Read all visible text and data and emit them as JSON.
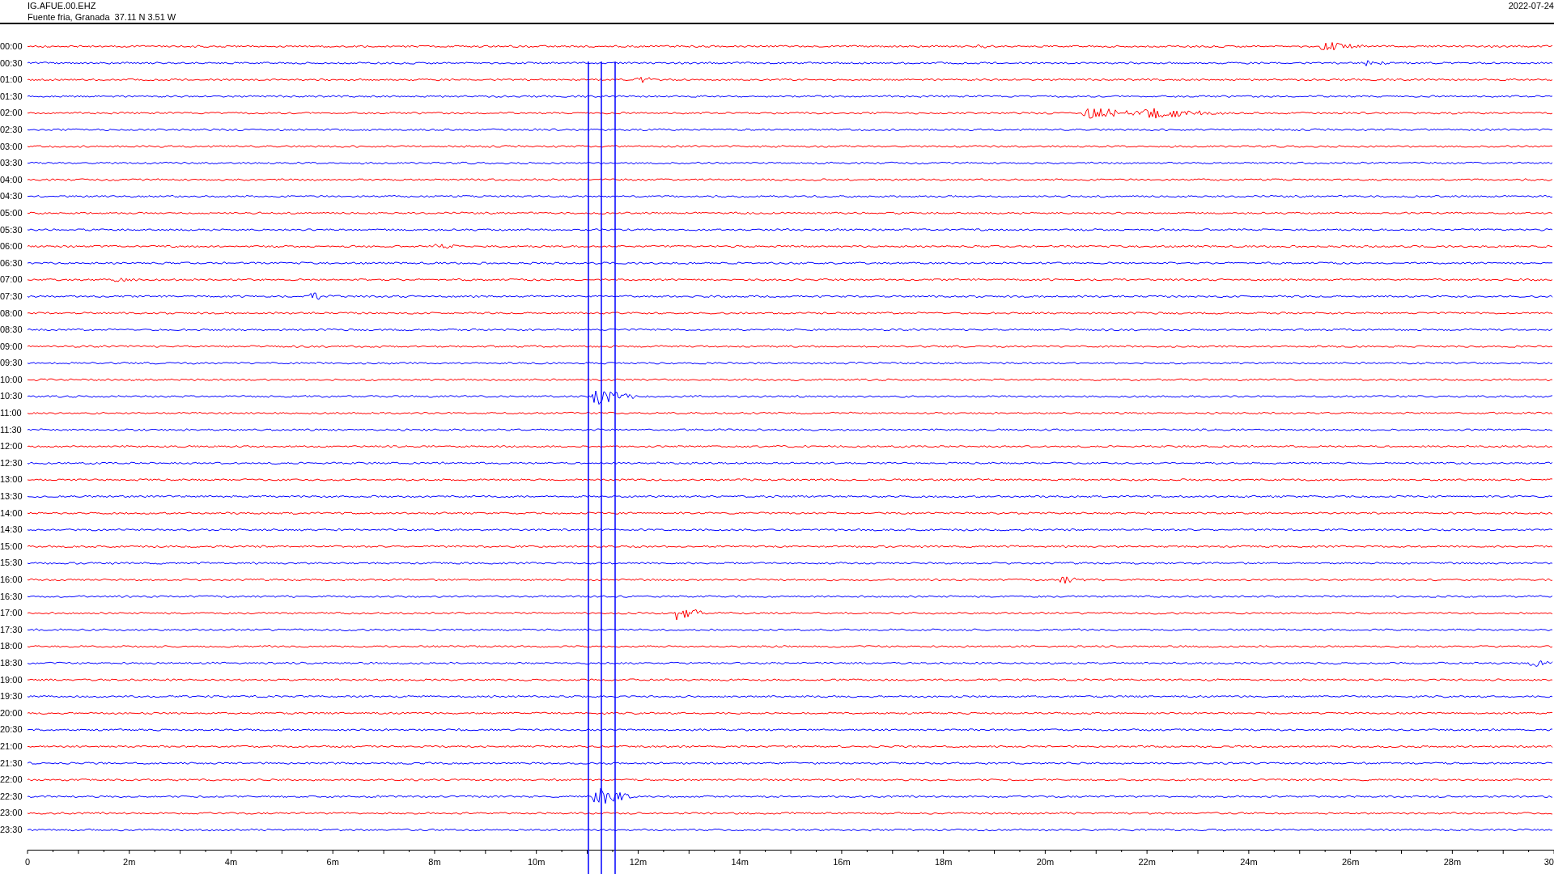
{
  "header": {
    "station": "IG.AFUE.00.EHZ",
    "location": "Fuente fria, Granada  37.11 N 3.51 W",
    "date": "2022-07-24"
  },
  "rows": [
    {
      "time": "00:00",
      "color": "#ff0000"
    },
    {
      "time": "00:30",
      "color": "#0000ff"
    },
    {
      "time": "01:00",
      "color": "#ff0000"
    },
    {
      "time": "01:30",
      "color": "#0000ff"
    },
    {
      "time": "02:00",
      "color": "#ff0000"
    },
    {
      "time": "02:30",
      "color": "#0000ff"
    },
    {
      "time": "03:00",
      "color": "#ff0000"
    },
    {
      "time": "03:30",
      "color": "#0000ff"
    },
    {
      "time": "04:00",
      "color": "#ff0000"
    },
    {
      "time": "04:30",
      "color": "#0000ff"
    },
    {
      "time": "05:00",
      "color": "#ff0000"
    },
    {
      "time": "05:30",
      "color": "#0000ff"
    },
    {
      "time": "06:00",
      "color": "#ff0000"
    },
    {
      "time": "06:30",
      "color": "#0000ff"
    },
    {
      "time": "07:00",
      "color": "#ff0000"
    },
    {
      "time": "07:30",
      "color": "#0000ff"
    },
    {
      "time": "08:00",
      "color": "#ff0000"
    },
    {
      "time": "08:30",
      "color": "#0000ff"
    },
    {
      "time": "09:00",
      "color": "#ff0000"
    },
    {
      "time": "09:30",
      "color": "#0000ff"
    },
    {
      "time": "10:00",
      "color": "#ff0000"
    },
    {
      "time": "10:30",
      "color": "#0000ff"
    },
    {
      "time": "11:00",
      "color": "#ff0000"
    },
    {
      "time": "11:30",
      "color": "#0000ff"
    },
    {
      "time": "12:00",
      "color": "#ff0000"
    },
    {
      "time": "12:30",
      "color": "#0000ff"
    },
    {
      "time": "13:00",
      "color": "#ff0000"
    },
    {
      "time": "13:30",
      "color": "#0000ff"
    },
    {
      "time": "14:00",
      "color": "#ff0000"
    },
    {
      "time": "14:30",
      "color": "#0000ff"
    },
    {
      "time": "15:00",
      "color": "#ff0000"
    },
    {
      "time": "15:30",
      "color": "#0000ff"
    },
    {
      "time": "16:00",
      "color": "#ff0000"
    },
    {
      "time": "16:30",
      "color": "#0000ff"
    },
    {
      "time": "17:00",
      "color": "#ff0000"
    },
    {
      "time": "17:30",
      "color": "#0000ff"
    },
    {
      "time": "18:00",
      "color": "#ff0000"
    },
    {
      "time": "18:30",
      "color": "#0000ff"
    },
    {
      "time": "19:00",
      "color": "#ff0000"
    },
    {
      "time": "19:30",
      "color": "#0000ff"
    },
    {
      "time": "20:00",
      "color": "#ff0000"
    },
    {
      "time": "20:30",
      "color": "#0000ff"
    },
    {
      "time": "21:00",
      "color": "#ff0000"
    },
    {
      "time": "21:30",
      "color": "#0000ff"
    },
    {
      "time": "22:00",
      "color": "#ff0000"
    },
    {
      "time": "22:30",
      "color": "#0000ff"
    },
    {
      "time": "23:00",
      "color": "#ff0000"
    },
    {
      "time": "23:30",
      "color": "#0000ff"
    }
  ],
  "x_axis": {
    "labels": [
      "0",
      "2m",
      "4m",
      "6m",
      "8m",
      "10m",
      "12m",
      "14m",
      "16m",
      "18m",
      "20m",
      "22m",
      "24m",
      "26m",
      "28m",
      "30"
    ]
  }
}
